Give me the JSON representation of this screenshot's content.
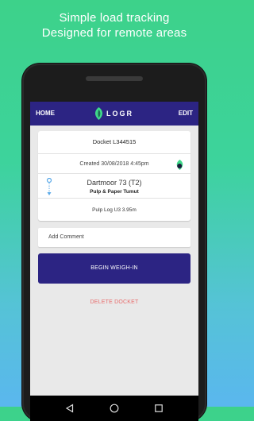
{
  "promo": {
    "line1": "Simple load tracking",
    "line2": "Designed for remote areas"
  },
  "appbar": {
    "home_label": "HOME",
    "logo_text": "LOGR",
    "edit_label": "EDIT"
  },
  "docket": {
    "title": "Docket L344515",
    "created": "Created 30/08/2018 4:45pm",
    "origin": "Dartmoor 73 (T2)",
    "destination": "Pulp & Paper Tumut",
    "product": "Pulp Log U3 3.95m"
  },
  "comment": {
    "placeholder": "Add Comment"
  },
  "actions": {
    "weigh_in_label": "BEGIN WEIGH-IN",
    "delete_label": "DELETE DOCKET"
  },
  "colors": {
    "primary": "#2c2483",
    "accent_green": "#3fd98a",
    "danger": "#e86c6c",
    "marker_blue": "#5aa9e8"
  },
  "icons": {
    "logo": "leaf-logo-icon",
    "created_status": "leaf-status-icon",
    "route": "route-marker-icon",
    "nav_back": "back-triangle-icon",
    "nav_home": "home-circle-icon",
    "nav_recent": "recent-square-icon"
  }
}
